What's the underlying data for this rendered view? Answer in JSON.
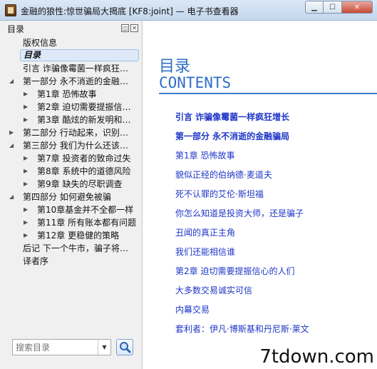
{
  "window": {
    "title": "金融的狼性:惊世骗局大揭底 [KF8:joint] — 电子书查看器",
    "min_label": "▁",
    "max_label": "☐",
    "close_label": "✕"
  },
  "sidebar": {
    "header": "目录",
    "float_label": "◫",
    "close_label": "✕",
    "items": [
      {
        "label": "版权信息"
      },
      {
        "label": "目录"
      },
      {
        "label": "引言  诈骗像霉菌一样疯狂…"
      },
      {
        "label": "第一部分  永不消逝的金融…"
      },
      {
        "label": "第1章  恐怖故事"
      },
      {
        "label": "第2章  迫切需要提振信…"
      },
      {
        "label": "第3章  酷炫的新发明和…"
      },
      {
        "label": "第二部分  行动起来，识别…"
      },
      {
        "label": "第三部分  我们为什么还该…"
      },
      {
        "label": "第7章  投资者的致命过失"
      },
      {
        "label": "第8章  系统中的道德风险"
      },
      {
        "label": "第9章  缺失的尽职调查"
      },
      {
        "label": "第四部分  如何避免被骗"
      },
      {
        "label": "第10章基金并不全都一样"
      },
      {
        "label": "第11章  所有账本都有问题"
      },
      {
        "label": "第12章  更稳健的策略"
      },
      {
        "label": "后记  下一个牛市，骗子将…"
      },
      {
        "label": "译者序"
      }
    ],
    "search": {
      "placeholder": "搜索目录",
      "dropdown_label": "▼"
    }
  },
  "main": {
    "title": "目录",
    "subtitle": "CONTENTS",
    "entries": [
      {
        "label": "引言  诈骗像霉菌一样疯狂增长"
      },
      {
        "label": "第一部分  永不消逝的金融骗局"
      },
      {
        "label": "第1章  恐怖故事"
      },
      {
        "label": "貌似正经的伯纳德·麦道夫"
      },
      {
        "label": "死不认罪的艾伦·斯坦福"
      },
      {
        "label": "你怎么知道是投资大师，还是骗子"
      },
      {
        "label": "丑闻的真正主角"
      },
      {
        "label": "我们还能相信谁"
      },
      {
        "label": "第2章  迫切需要提振信心的人们"
      },
      {
        "label": "大多数交易诚实可信"
      },
      {
        "label": "内幕交易"
      },
      {
        "label": "套利者：伊凡·博斯基和丹尼斯·莱文"
      }
    ]
  },
  "watermark": "7tdown.com",
  "colors": {
    "accent": "#2f6fc6",
    "link": "#1f36c7"
  }
}
